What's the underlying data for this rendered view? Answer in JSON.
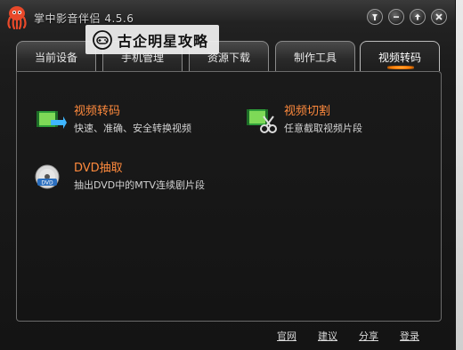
{
  "app": {
    "title": "掌中影音伴侣 4.5.6"
  },
  "watermark": {
    "text": "古企明星攻略"
  },
  "tabs": [
    {
      "label": "当前设备"
    },
    {
      "label": "手机管理"
    },
    {
      "label": "资源下载"
    },
    {
      "label": "制作工具"
    },
    {
      "label": "视频转码"
    }
  ],
  "features": {
    "video_convert": {
      "title": "视频转码",
      "desc": "快速、准确、安全转换视频"
    },
    "video_cut": {
      "title": "视频切割",
      "desc": "任意截取视频片段"
    },
    "dvd_extract": {
      "title": "DVD抽取",
      "desc": "抽出DVD中的MTV连续剧片段"
    }
  },
  "footer": {
    "links": [
      "官网",
      "建议",
      "分享",
      "登录"
    ]
  },
  "icons": {
    "app_logo": "octopus-icon",
    "pin": "pin-icon",
    "minimize": "minimize-icon",
    "restore": "arrow-up-icon",
    "close": "close-icon",
    "watermark": "game-controller-icon",
    "video_convert": "film-convert-icon",
    "video_cut": "film-scissors-icon",
    "dvd_extract": "dvd-disc-icon"
  },
  "colors": {
    "accent": "#ff8a3d",
    "tab_indicator": "#ff7a00",
    "window_bg": "#141414"
  }
}
